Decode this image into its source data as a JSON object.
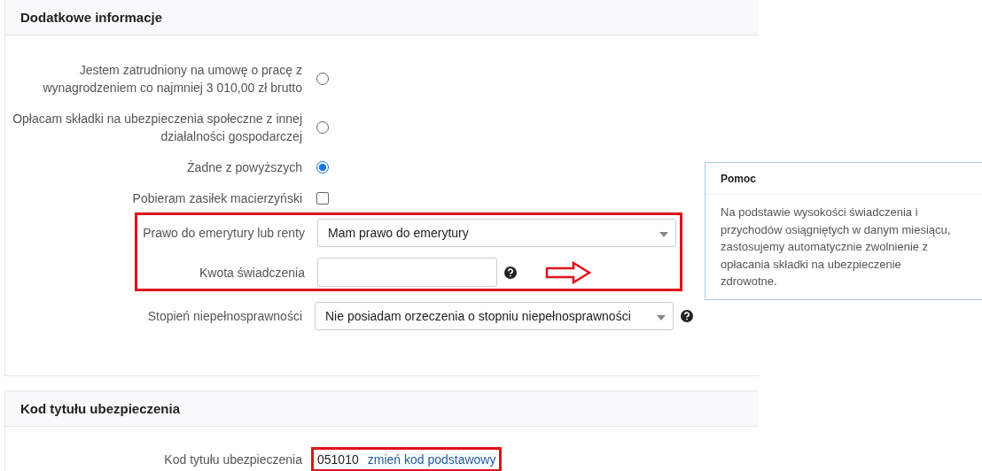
{
  "sections": [
    {
      "title": "Dodatkowe informacje",
      "fields": [
        {
          "kind": "radio",
          "label": "Jestem zatrudniony na umowę o pracę z wynagrodzeniem co najmniej 3 010,00 zł brutto",
          "selected": false
        },
        {
          "kind": "radio",
          "label": "Opłacam składki na ubezpieczenia społeczne z innej działalności gospodarczej",
          "selected": false
        },
        {
          "kind": "radio",
          "label": "Żadne z powyższych",
          "selected": true
        },
        {
          "kind": "checkbox",
          "label": "Pobieram zasiłek macierzyński",
          "checked": false
        },
        {
          "kind": "group",
          "children": [
            {
              "kind": "select",
              "label": "Prawo do emerytury lub renty",
              "value": "Mam prawo do emerytury",
              "help": false
            },
            {
              "kind": "input",
              "label": "Kwota świadczenia",
              "help": true
            }
          ]
        },
        {
          "kind": "select",
          "label": "Stopień niepełnosprawności",
          "value": "Nie posiadam orzeczenia o stopniu niepełnosprawności",
          "help": true
        }
      ]
    },
    {
      "title": "Kod tytułu ubezpieczenia",
      "code_row": {
        "label": "Kod tytułu ubezpieczenia",
        "code": "051010",
        "link": "zmień kod podstawowy"
      }
    }
  ],
  "help_panel": {
    "title": "Pomoc",
    "text": "Na podstawie wysokości świadczenia i przychodów osiągniętych w danym miesiącu, zastosujemy automatycznie zwolnienie z opłacania składki na ubezpieczenie zdrowotne."
  }
}
